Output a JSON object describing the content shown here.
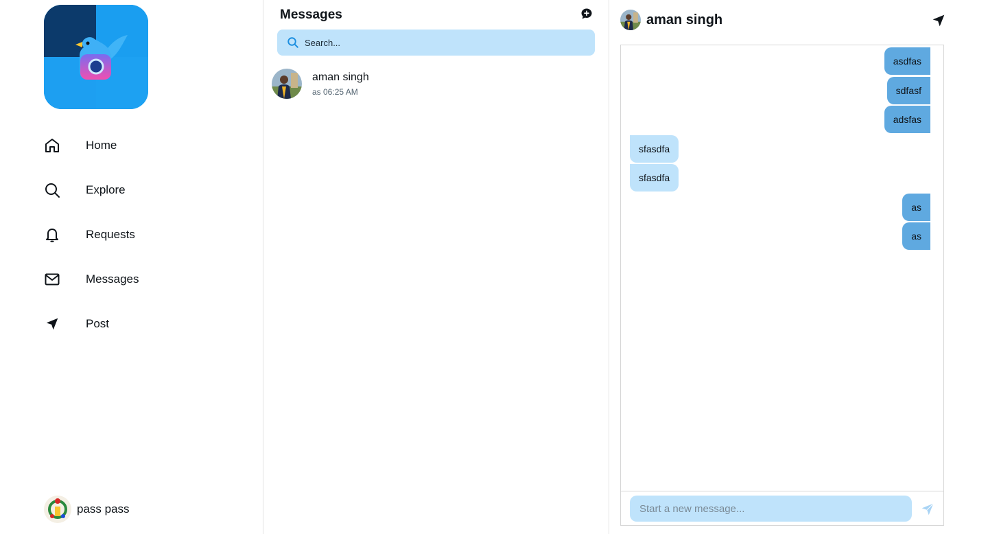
{
  "sidebar": {
    "nav": [
      {
        "label": "Home",
        "icon": "home-icon"
      },
      {
        "label": "Explore",
        "icon": "search-icon"
      },
      {
        "label": "Requests",
        "icon": "bell-icon"
      },
      {
        "label": "Messages",
        "icon": "envelope-icon"
      },
      {
        "label": "Post",
        "icon": "send-arrow-icon"
      }
    ],
    "current_user": {
      "name": "pass pass"
    }
  },
  "messages_list": {
    "title": "Messages",
    "search_placeholder": "Search...",
    "conversations": [
      {
        "name": "aman singh",
        "preview": "as 06:25 AM"
      }
    ]
  },
  "chat": {
    "contact_name": "aman singh",
    "messages": [
      {
        "text": "asdfas",
        "direction": "out"
      },
      {
        "text": "sdfasf",
        "direction": "out"
      },
      {
        "text": "adsfas",
        "direction": "out"
      },
      {
        "text": "sfasdfa",
        "direction": "in"
      },
      {
        "text": "sfasdfa",
        "direction": "in"
      },
      {
        "text": "as",
        "direction": "out"
      },
      {
        "text": "as",
        "direction": "out"
      }
    ],
    "composer_placeholder": "Start a new message..."
  },
  "colors": {
    "accent": "#1da1f2",
    "outgoing_bubble": "#5fa9e0",
    "incoming_bubble": "#bfe3fb",
    "input_background": "#bfe3fb"
  }
}
